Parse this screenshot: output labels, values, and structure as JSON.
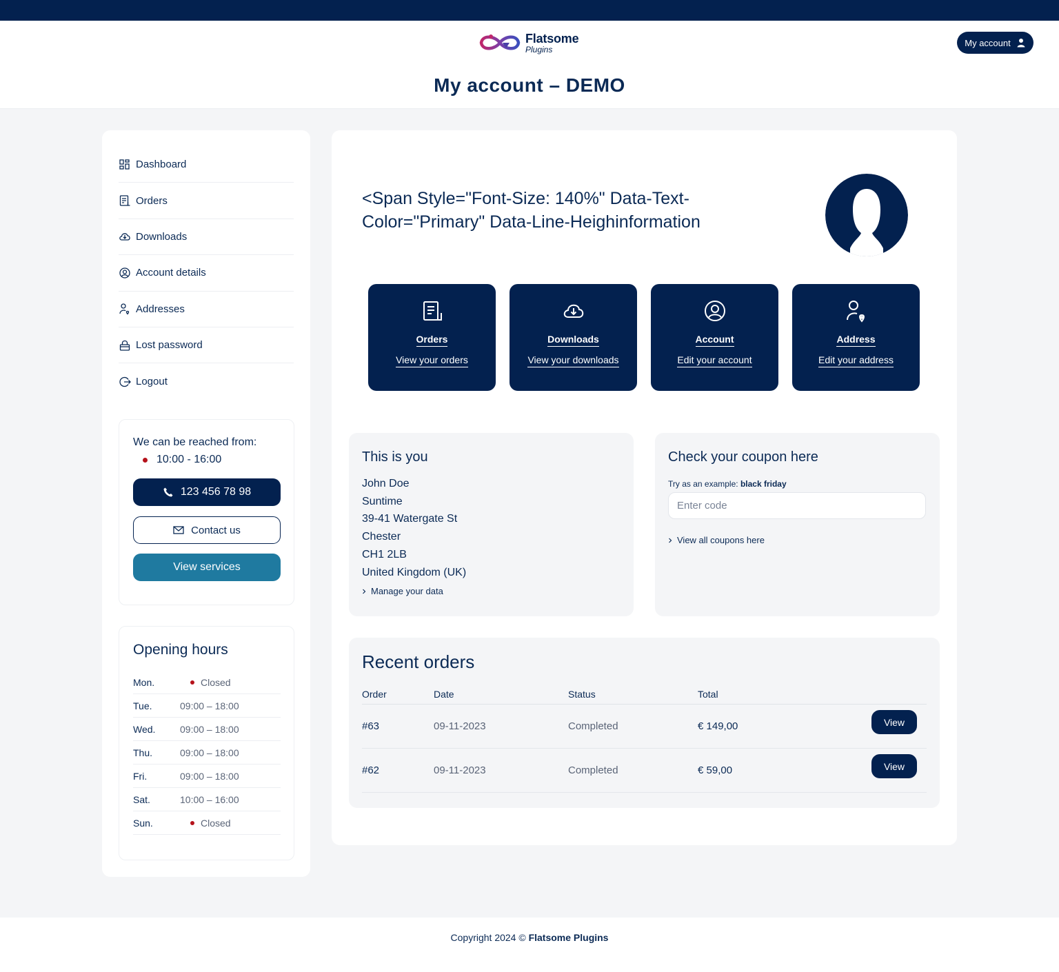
{
  "header": {
    "brand": "Flatsome",
    "brand_sub": "Plugins",
    "account_button": "My account",
    "page_title": "My account – DEMO"
  },
  "sidebar": {
    "nav": [
      {
        "label": "Dashboard",
        "icon": "dashboard-icon"
      },
      {
        "label": "Orders",
        "icon": "orders-icon"
      },
      {
        "label": "Downloads",
        "icon": "downloads-icon"
      },
      {
        "label": "Account details",
        "icon": "account-icon"
      },
      {
        "label": "Addresses",
        "icon": "address-icon"
      },
      {
        "label": "Lost password",
        "icon": "lock-icon"
      },
      {
        "label": "Logout",
        "icon": "logout-icon"
      }
    ],
    "reach": {
      "label": "We can be reached from:",
      "hours": "10:00 - 16:00",
      "phone": "123 456 78 98",
      "contact": "Contact us",
      "services": "View services"
    },
    "opening_hours": {
      "title": "Opening hours",
      "rows": [
        {
          "day": "Mon.",
          "time": "Closed",
          "closed": true
        },
        {
          "day": "Tue.",
          "time": "09:00 – 18:00",
          "closed": false
        },
        {
          "day": "Wed.",
          "time": "09:00 – 18:00",
          "closed": false
        },
        {
          "day": "Thu.",
          "time": "09:00 – 18:00",
          "closed": false
        },
        {
          "day": "Fri.",
          "time": "09:00 – 18:00",
          "closed": false
        },
        {
          "day": "Sat.",
          "time": "10:00 – 16:00",
          "closed": false
        },
        {
          "day": "Sun.",
          "time": "Closed",
          "closed": true
        }
      ]
    }
  },
  "main": {
    "greeting": "<Span Style=\"Font-Size: 140%\" Data-Text-Color=\"Primary\" Data-Line-Heighinformation",
    "tiles": [
      {
        "title": "Orders",
        "subtitle": "View your orders",
        "icon": "orders-icon"
      },
      {
        "title": "Downloads",
        "subtitle": "View your downloads",
        "icon": "downloads-icon"
      },
      {
        "title": "Account",
        "subtitle": "Edit your account",
        "icon": "account-icon"
      },
      {
        "title": "Address",
        "subtitle": "Edit your address",
        "icon": "address-icon"
      }
    ],
    "you": {
      "title": "This is you",
      "lines": [
        "John Doe",
        "Suntime",
        "39-41 Watergate St",
        "Chester",
        "CH1 2LB",
        "United Kingdom (UK)"
      ],
      "manage": "Manage your data"
    },
    "coupon": {
      "title": "Check your coupon here",
      "try_prefix": "Try as an example:",
      "try_code": "black friday",
      "placeholder": "Enter code",
      "view_all": "View all coupons here"
    },
    "orders": {
      "title": "Recent orders",
      "columns": [
        "Order",
        "Date",
        "Status",
        "Total"
      ],
      "rows": [
        {
          "order": "#63",
          "date": "09-11-2023",
          "status": "Completed",
          "total": "€ 149,00",
          "action": "View"
        },
        {
          "order": "#62",
          "date": "09-11-2023",
          "status": "Completed",
          "total": "€ 59,00",
          "action": "View"
        }
      ]
    }
  },
  "footer": {
    "copyright_prefix": "Copyright 2024 ©",
    "copyright_brand": "Flatsome Plugins"
  },
  "colors": {
    "primary": "#03214f",
    "secondary": "#1f7aa0",
    "background": "#f4f5f7",
    "status_closed": "#b5121b"
  }
}
